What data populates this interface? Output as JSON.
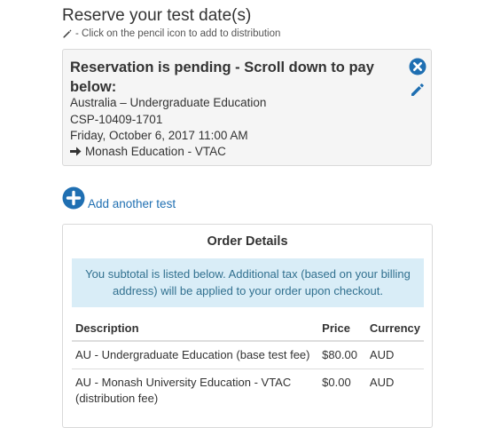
{
  "page": {
    "title": "Reserve your test date(s)",
    "hint": "- Click on the pencil icon to add to distribution"
  },
  "reservation": {
    "status_title": "Reservation is pending - Scroll down to pay below:",
    "country_program": "Australia – Undergraduate Education",
    "code": "CSP-10409-1701",
    "datetime": "Friday, October 6, 2017 11:00 AM",
    "distribution": "Monash Education - VTAC"
  },
  "actions": {
    "add_test_label": "Add another test"
  },
  "order": {
    "title": "Order Details",
    "info": "You subtotal is listed below. Additional tax (based on your billing address) will be applied to your order upon checkout.",
    "columns": [
      "Description",
      "Price",
      "Currency"
    ],
    "rows": [
      {
        "description": "AU - Undergraduate Education (base test fee)",
        "price": "$80.00",
        "currency": "AUD"
      },
      {
        "description": "AU - Monash University Education - VTAC (distribution fee)",
        "price": "$0.00",
        "currency": "AUD"
      }
    ]
  },
  "colors": {
    "accent": "#1f6fb2",
    "info_bg": "#d9edf7",
    "info_text": "#31708f",
    "card_bg": "#f5f5f5"
  },
  "icons": {
    "hint": "pencil-icon",
    "remove": "circle-x-icon",
    "edit": "pencil-icon",
    "distribution": "arrow-right-icon",
    "add": "circle-plus-icon"
  }
}
